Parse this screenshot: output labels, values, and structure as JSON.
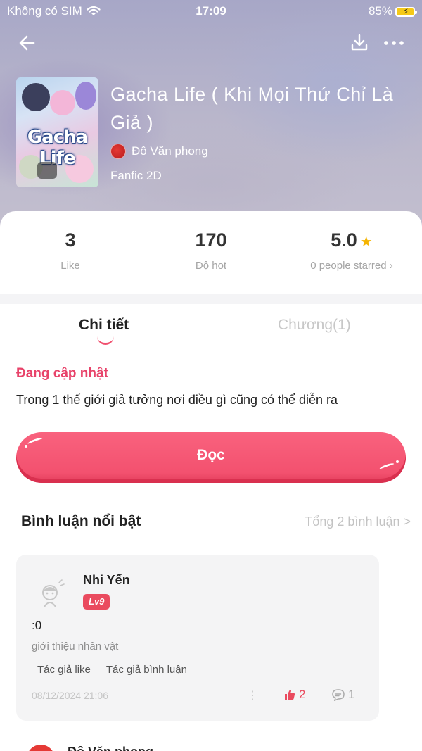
{
  "status_bar": {
    "carrier": "Không có SIM",
    "time": "17:09",
    "battery": "85%"
  },
  "book": {
    "title": "Gacha Life ( Khi Mọi Thứ Chỉ Là Giả )",
    "cover_text": "Gacha Life",
    "author": "Đô Văn phong",
    "genre": "Fanfic 2D"
  },
  "stats": {
    "likes": {
      "value": "3",
      "label": "Like"
    },
    "hot": {
      "value": "170",
      "label": "Độ hot"
    },
    "rating": {
      "value": "5.0",
      "label": "0 people starred ›"
    }
  },
  "tabs": [
    {
      "label": "Chi tiết",
      "active": true
    },
    {
      "label": "Chương(1)",
      "active": false
    }
  ],
  "detail": {
    "status": "Đang cập nhật",
    "description": "Trong 1 thế giới giả tưởng nơi điều gì cũng có thể diễn ra"
  },
  "read_button": "Đọc",
  "comments": {
    "title": "Bình luận nổi bật",
    "total_link": "Tổng 2 bình luận >",
    "items": [
      {
        "name": "Nhi Yến",
        "level": "Lv9",
        "text": ":0",
        "chapter": "giới thiệu nhân vật",
        "tags": [
          "Tác giả like",
          "Tác giả bình luận"
        ],
        "date": "08/12/2024 21:06",
        "likes": "2",
        "replies": "1"
      }
    ],
    "next_name": "Đô Văn phong"
  },
  "colors": {
    "accent": "#f3516f",
    "level_badge": "#ea4b5f",
    "star": "#f5b400"
  }
}
